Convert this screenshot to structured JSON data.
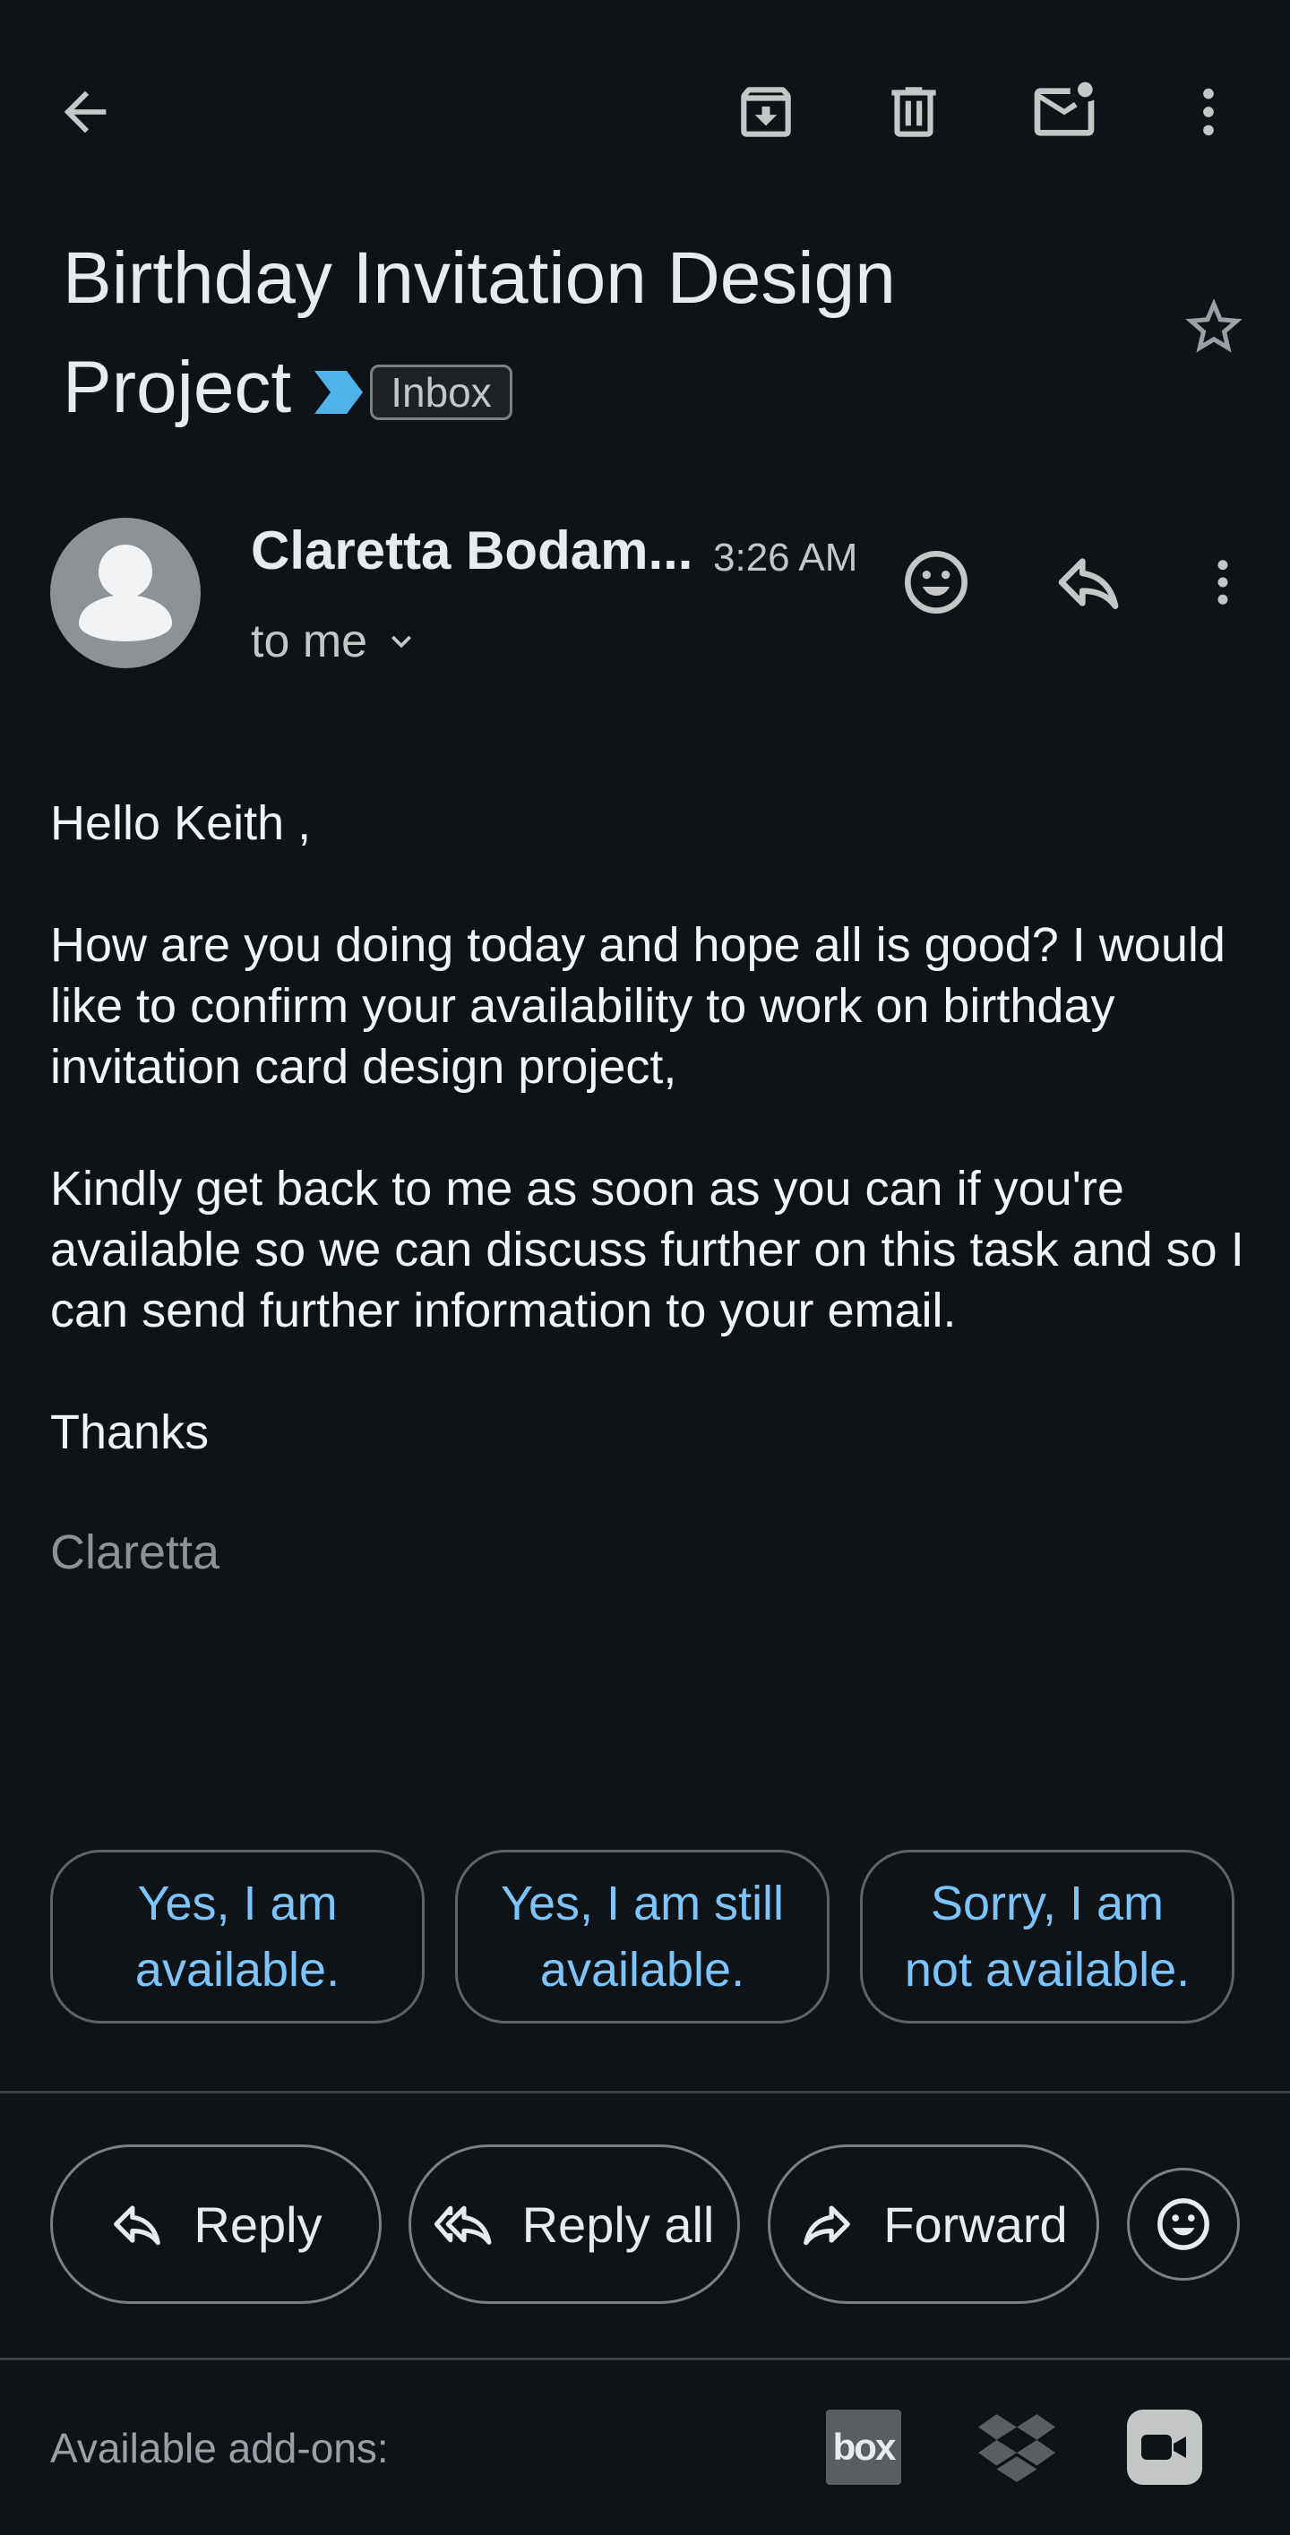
{
  "toolbar": {
    "back_icon": "arrow-left-icon",
    "archive_icon": "archive-icon",
    "delete_icon": "trash-icon",
    "mark_unread_icon": "mail-unread-icon",
    "more_icon": "more-vert-icon"
  },
  "message": {
    "subject": "Birthday Invitation Design Project",
    "label": "Inbox",
    "label_arrow_color": "#4fb3ea",
    "starred": false
  },
  "sender": {
    "name": "Claretta Bodam...",
    "time": "3:26 AM",
    "recipient": "to me"
  },
  "body": {
    "greeting": "Hello Keith ,",
    "paragraph1": "How are you doing today and hope all is good? I would like to confirm your availability to work on birthday invitation card design project,",
    "paragraph2": "Kindly get back to me as soon as you can if you're available so we can discuss further on this task and so I can send further information to your email.",
    "closing": "Thanks",
    "signature": "Claretta"
  },
  "smart_replies": [
    {
      "line1": "Yes, I am",
      "line2": "available."
    },
    {
      "line1": "Yes, I am still",
      "line2": "available."
    },
    {
      "line1": "Sorry, I am",
      "line2": "not available."
    }
  ],
  "actions": {
    "reply": "Reply",
    "reply_all": "Reply all",
    "forward": "Forward"
  },
  "addons": {
    "label": "Available add-ons:",
    "box_text": "box",
    "items": [
      "box-icon",
      "dropbox-icon",
      "meet-video-icon"
    ]
  }
}
